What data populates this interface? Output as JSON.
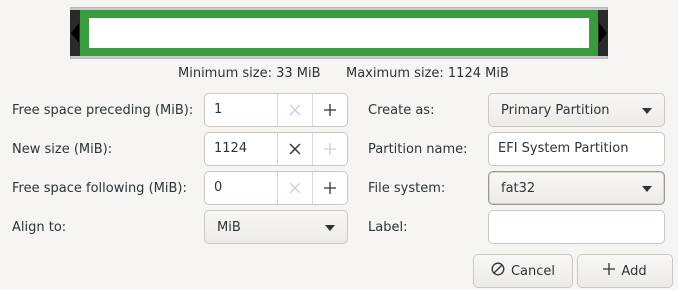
{
  "visualizer": {
    "fill_color": "#3a9a3e",
    "left_handle_icon": "triangle-left-icon",
    "right_handle_icon": "triangle-right-icon"
  },
  "size_info": {
    "minimum": "Minimum size: 33 MiB",
    "maximum": "Maximum size: 1124 MiB"
  },
  "left": {
    "free_preceding": {
      "label": "Free space preceding (MiB):",
      "value": "1",
      "clear_icon": "clear-x-icon",
      "clear_enabled": false,
      "add_icon": "plus-icon",
      "add_enabled": true
    },
    "new_size": {
      "label": "New size (MiB):",
      "value": "1124",
      "clear_icon": "clear-x-icon",
      "clear_enabled": true,
      "add_icon": "plus-icon",
      "add_enabled": false
    },
    "free_following": {
      "label": "Free space following (MiB):",
      "value": "0",
      "clear_icon": "clear-x-icon",
      "clear_enabled": false,
      "add_icon": "plus-icon",
      "add_enabled": true
    },
    "align_to": {
      "label": "Align to:",
      "value": "MiB",
      "arrow_icon": "chevron-down-icon"
    }
  },
  "right": {
    "create_as": {
      "label": "Create as:",
      "value": "Primary Partition",
      "arrow_icon": "chevron-down-icon"
    },
    "partition_name": {
      "label": "Partition name:",
      "value": "EFI System Partition"
    },
    "file_system": {
      "label": "File system:",
      "value": "fat32",
      "arrow_icon": "chevron-down-icon"
    },
    "label": {
      "label": "Label:",
      "value": ""
    }
  },
  "actions": {
    "cancel": {
      "label": "Cancel",
      "icon": "cancel-circle-icon"
    },
    "add": {
      "label": "Add",
      "icon": "plus-icon"
    }
  }
}
